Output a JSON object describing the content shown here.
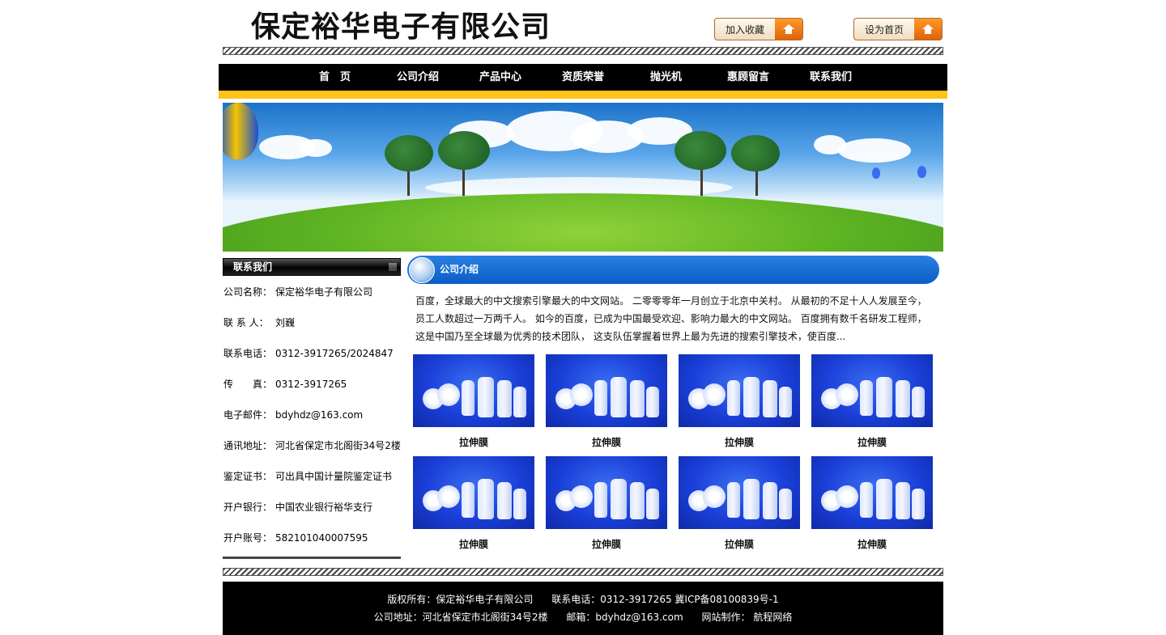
{
  "header": {
    "logo_text": "保定裕华电子有限公司",
    "favorite_label": "加入收藏",
    "homepage_label": "设为首页"
  },
  "nav": {
    "items": [
      "首　页",
      "公司介绍",
      "产品中心",
      "资质荣誉",
      "抛光机",
      "惠顾留言",
      "联系我们"
    ]
  },
  "sidebar": {
    "title": "联系我们",
    "contacts": [
      {
        "key": "公司名称：",
        "value": "保定裕华电子有限公司"
      },
      {
        "key": "联 系 人：",
        "value": "刘巍"
      },
      {
        "key": "联系电话：",
        "value": "0312-3917265/2024847"
      },
      {
        "key": "传　　真：",
        "value": "0312-3917265"
      },
      {
        "key": "电子邮件：",
        "value": "bdyhdz@163.com"
      },
      {
        "key": "通讯地址：",
        "value": "河北省保定市北阁街34号2楼"
      },
      {
        "key": "鉴定证书：",
        "value": "可出具中国计量院鉴定证书"
      },
      {
        "key": "开户银行：",
        "value": "中国农业银行裕华支行"
      },
      {
        "key": "开户账号：",
        "value": "582101040007595"
      }
    ]
  },
  "main": {
    "title": "公司介绍",
    "intro": "百度，全球最大的中文搜索引擎最大的中文网站。 二零零零年一月创立于北京中关村。 从最初的不足十人人发展至今，员工人数超过一万两千人。 如今的百度，已成为中国最受欢迎、影响力最大的中文网站。 百度拥有数千名研发工程师，这是中国乃至全球最为优秀的技术团队， 这支队伍掌握着世界上最为先进的搜索引擎技术，使百度...",
    "products": [
      "拉伸膜",
      "拉伸膜",
      "拉伸膜",
      "拉伸膜",
      "拉伸膜",
      "拉伸膜",
      "拉伸膜",
      "拉伸膜"
    ]
  },
  "footer": {
    "line1": "版权所有：保定裕华电子有限公司      联系电话：0312-3917265 冀ICP备08100839号-1",
    "line2": "公司地址：河北省保定市北阁街34号2楼      邮箱：bdyhdz@163.com      网站制作： 航程网络"
  },
  "colors": {
    "nav_bg": "#000000",
    "nav_stripe": "#ffc21a",
    "title_blue": "#0a5dc8",
    "button_orange": "#e0620a"
  }
}
